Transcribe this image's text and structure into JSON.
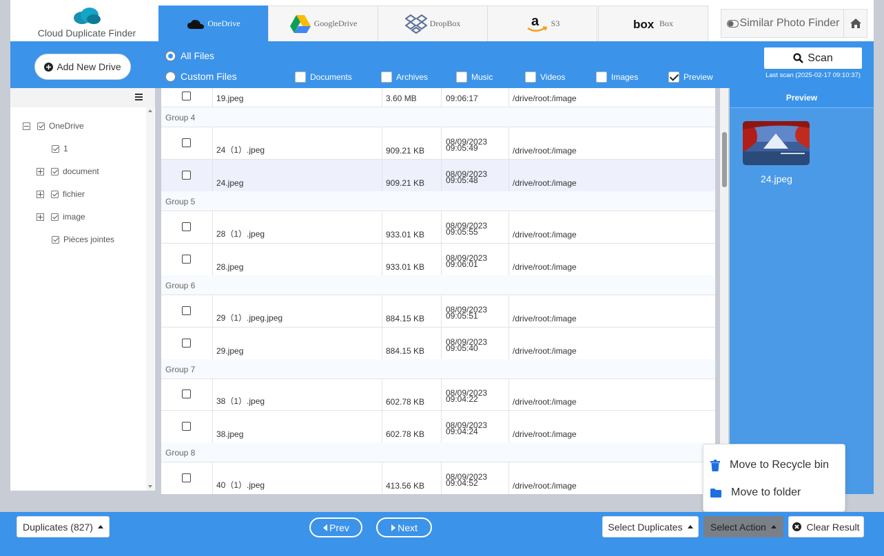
{
  "app": {
    "title": "Cloud Duplicate Finder"
  },
  "tabs": [
    {
      "label": "OneDrive",
      "icon": "onedrive-icon"
    },
    {
      "label": "GoogleDrive",
      "icon": "googledrive-icon"
    },
    {
      "label": "DropBox",
      "icon": "dropbox-icon"
    },
    {
      "label": "S3",
      "icon": "amazon-s3-icon"
    },
    {
      "label": "Box",
      "icon": "box-icon"
    }
  ],
  "header": {
    "similar_photo_label": "Similar Photo Finder"
  },
  "toolbar": {
    "add_drive_label": "Add New Drive",
    "all_files_label": "All Files",
    "custom_files_label": "Custom Files",
    "filters": [
      {
        "label": "Documents",
        "checked": false
      },
      {
        "label": "Archives",
        "checked": false
      },
      {
        "label": "Music",
        "checked": false
      },
      {
        "label": "Videos",
        "checked": false
      },
      {
        "label": "Images",
        "checked": false
      },
      {
        "label": "Preview",
        "checked": true
      }
    ],
    "scan_label": "Scan",
    "last_scan": "Last scan (2025-02-17 09:10:37)"
  },
  "tree": {
    "items": [
      {
        "label": "OneDrive"
      },
      {
        "label": "1"
      },
      {
        "label": "document"
      },
      {
        "label": "fichier"
      },
      {
        "label": "image"
      },
      {
        "label": "Pièces jointes"
      }
    ]
  },
  "table": {
    "partial_row": {
      "name": "19.jpeg",
      "size": "3.60 MB",
      "time": "09:06:17",
      "path": "/drive/root:/image"
    },
    "groups": [
      {
        "label": "Group 4",
        "rows": [
          {
            "name": "24（1）.jpeg",
            "size": "909.21 KB",
            "date": "08/09/2023",
            "time": "09:05:49",
            "path": "/drive/root:/image"
          },
          {
            "name": "24.jpeg",
            "size": "909.21 KB",
            "date": "08/09/2023",
            "time": "09:05:48",
            "path": "/drive/root:/image"
          }
        ]
      },
      {
        "label": "Group 5",
        "rows": [
          {
            "name": "28（1）.jpeg",
            "size": "933.01 KB",
            "date": "08/09/2023",
            "time": "09:05:55",
            "path": "/drive/root:/image"
          },
          {
            "name": "28.jpeg",
            "size": "933.01 KB",
            "date": "08/09/2023",
            "time": "09:06:01",
            "path": "/drive/root:/image"
          }
        ]
      },
      {
        "label": "Group 6",
        "rows": [
          {
            "name": "29（1）.jpeg.jpeg",
            "size": "884.15 KB",
            "date": "08/09/2023",
            "time": "09:05:51",
            "path": "/drive/root:/image"
          },
          {
            "name": "29.jpeg",
            "size": "884.15 KB",
            "date": "08/09/2023",
            "time": "09:05:40",
            "path": "/drive/root:/image"
          }
        ]
      },
      {
        "label": "Group 7",
        "rows": [
          {
            "name": "38（1）.jpeg",
            "size": "602.78 KB",
            "date": "08/09/2023",
            "time": "09:04:22",
            "path": "/drive/root:/image"
          },
          {
            "name": "38.jpeg",
            "size": "602.78 KB",
            "date": "08/09/2023",
            "time": "09:04:24",
            "path": "/drive/root:/image"
          }
        ]
      },
      {
        "label": "Group 8",
        "rows": [
          {
            "name": "40（1）.jpeg",
            "size": "413.56 KB",
            "date": "08/09/2023",
            "time": "09:04:52",
            "path": "/drive/root:/image"
          }
        ]
      }
    ]
  },
  "preview": {
    "title": "Preview",
    "filename": "24.jpeg"
  },
  "action_menu": {
    "recycle_label": "Move to Recycle bin",
    "folder_label": "Move to folder"
  },
  "footer": {
    "duplicates_label": "Duplicates (827)",
    "prev_label": "Prev",
    "next_label": "Next",
    "select_duplicates_label": "Select Duplicates",
    "select_action_label": "Select Action",
    "clear_label": "Clear Result"
  },
  "colors": {
    "accent": "#3b93ea",
    "selected_row": "#eef0fb"
  }
}
